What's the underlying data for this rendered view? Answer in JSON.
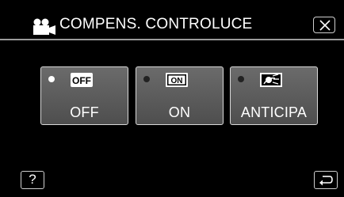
{
  "header": {
    "title": "COMPENS. CONTROLUCE",
    "mode_icon": "video-camera-icon",
    "close_icon": "close-icon"
  },
  "options": [
    {
      "id": "off",
      "label": "OFF",
      "badge": "OFF",
      "selected": true,
      "icon": "backlight-off-icon"
    },
    {
      "id": "on",
      "label": "ON",
      "badge": "ON",
      "selected": false,
      "icon": "backlight-on-icon"
    },
    {
      "id": "anticipa",
      "label": "ANTICIPA",
      "badge": "",
      "selected": false,
      "icon": "backlight-advance-icon"
    }
  ],
  "footer": {
    "help_label": "?",
    "back_icon": "return-icon"
  },
  "colors": {
    "background": "#000000",
    "button_fill": "#5e5e5e",
    "button_border": "#d9d9d9",
    "text": "#ffffff"
  }
}
